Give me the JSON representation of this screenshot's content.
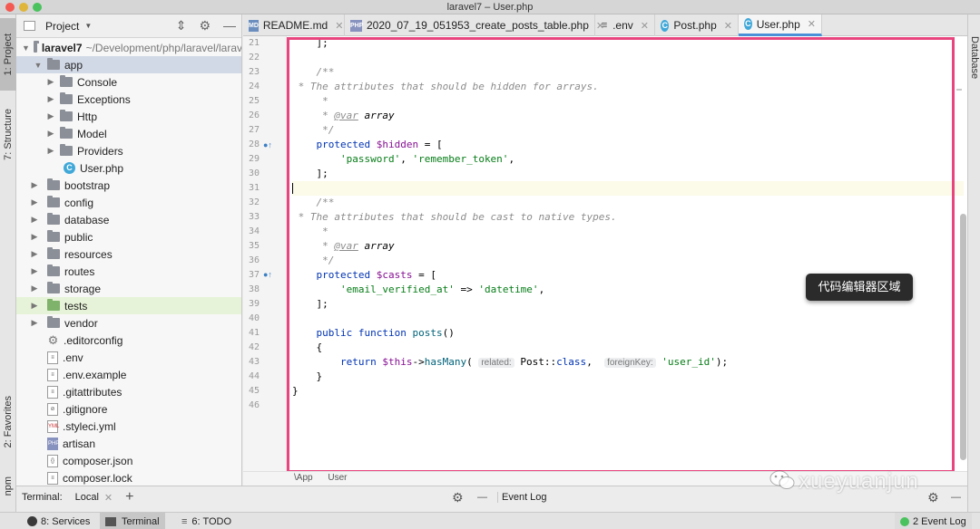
{
  "window": {
    "title": "laravel7 – User.php"
  },
  "left_strip": {
    "project": "1: Project",
    "structure": "7: Structure",
    "favorites": "2: Favorites",
    "npm": "npm"
  },
  "right_strip": {
    "database": "Database"
  },
  "project_panel": {
    "title": "Project",
    "root_name": "laravel7",
    "root_path": "~/Development/php/laravel/larav",
    "items": [
      {
        "label": "app"
      },
      {
        "label": "Console"
      },
      {
        "label": "Exceptions"
      },
      {
        "label": "Http"
      },
      {
        "label": "Model"
      },
      {
        "label": "Providers"
      },
      {
        "label": "User.php"
      },
      {
        "label": "bootstrap"
      },
      {
        "label": "config"
      },
      {
        "label": "database"
      },
      {
        "label": "public"
      },
      {
        "label": "resources"
      },
      {
        "label": "routes"
      },
      {
        "label": "storage"
      },
      {
        "label": "tests"
      },
      {
        "label": "vendor"
      },
      {
        "label": ".editorconfig"
      },
      {
        "label": ".env"
      },
      {
        "label": ".env.example"
      },
      {
        "label": ".gitattributes"
      },
      {
        "label": ".gitignore"
      },
      {
        "label": ".styleci.yml"
      },
      {
        "label": "artisan"
      },
      {
        "label": "composer.json"
      },
      {
        "label": "composer.lock"
      }
    ]
  },
  "tabs": [
    {
      "label": "README.md",
      "icon": "MD"
    },
    {
      "label": "2020_07_19_051953_create_posts_table.php",
      "icon": "PHP"
    },
    {
      "label": ".env",
      "icon": "≡"
    },
    {
      "label": "Post.php",
      "icon": "C"
    },
    {
      "label": "User.php",
      "icon": "C"
    }
  ],
  "editor": {
    "line_numbers": [
      "21",
      "22",
      "23",
      "24",
      "25",
      "26",
      "27",
      "28",
      "29",
      "30",
      "31",
      "32",
      "33",
      "34",
      "35",
      "36",
      "37",
      "38",
      "39",
      "40",
      "41",
      "42",
      "43",
      "44",
      "45",
      "46"
    ],
    "comment_hidden": " * The attributes that should be hidden for arrays.",
    "comment_casts": " * The attributes that should be cast to native types.",
    "hint_related": "related:",
    "hint_foreign_key": "foreignKey:",
    "str_password": "'password'",
    "str_remember": "'remember_token'",
    "str_email_verified": "'email_verified_at'",
    "str_datetime": "'datetime'",
    "str_user_id": "'user_id'"
  },
  "annotation": {
    "label": "代码编辑器区域"
  },
  "breadcrumb": {
    "items": [
      "\\App",
      "User"
    ]
  },
  "terminal": {
    "label": "Terminal:",
    "tab": "Local",
    "event_log_title": "Event Log"
  },
  "watermark": {
    "text": "xueyuanjun"
  },
  "statusbar": {
    "services": "8: Services",
    "terminal": "Terminal",
    "todo": "6: TODO",
    "event_log": "2 Event Log"
  },
  "colors": {
    "accent": "#4a90d9",
    "annotation_border": "#e8457f",
    "tests_folder": "#7fb26a"
  }
}
